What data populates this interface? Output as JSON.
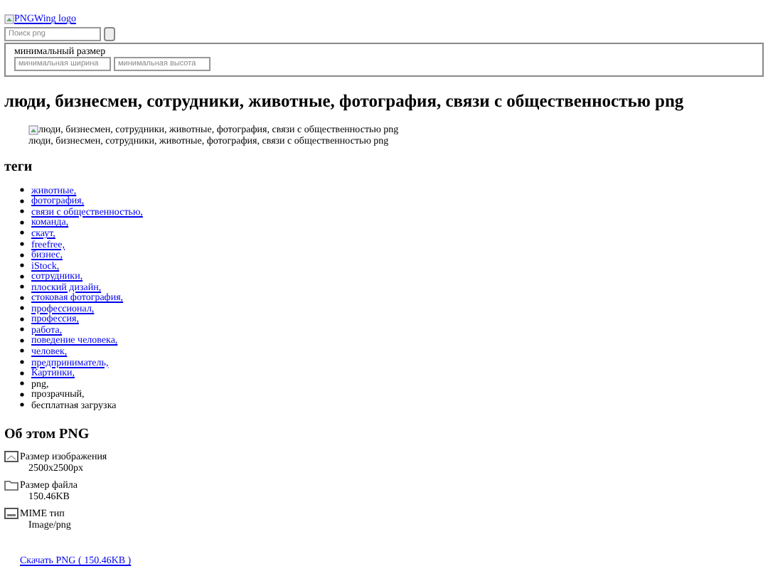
{
  "header": {
    "logo_alt": "PNGWing logo",
    "search": {
      "placeholder": "Поиск png"
    },
    "filter": {
      "legend": "минимальный размер",
      "fields": [
        {
          "placeholder": "минимальная ширина"
        },
        {
          "placeholder": "минимальная высота"
        }
      ]
    }
  },
  "title": "люди, бизнесмен, сотрудники, животные, фотография, связи с общественностью png",
  "image": {
    "alt": "люди, бизнесмен, сотрудники, животные, фотография, связи с общественностью png",
    "caption": "люди, бизнесмен, сотрудники, животные, фотография, связи с общественностью png"
  },
  "tags": {
    "heading": "теги",
    "items": [
      {
        "label": "животные,",
        "kind": "link"
      },
      {
        "label": "фотография,",
        "kind": "link"
      },
      {
        "label": "связи с общественностью,",
        "kind": "link"
      },
      {
        "label": "команда,",
        "kind": "link"
      },
      {
        "label": "скаут,",
        "kind": "link"
      },
      {
        "label": "freefree,",
        "kind": "link"
      },
      {
        "label": "бизнес,",
        "kind": "link"
      },
      {
        "label": "iStock,",
        "kind": "link"
      },
      {
        "label": "сотрудники,",
        "kind": "link"
      },
      {
        "label": "плоский дизайн,",
        "kind": "link"
      },
      {
        "label": "стоковая фотография,",
        "kind": "link"
      },
      {
        "label": "профессионал,",
        "kind": "link"
      },
      {
        "label": "профессия,",
        "kind": "link"
      },
      {
        "label": "работа,",
        "kind": "link"
      },
      {
        "label": "поведение человека,",
        "kind": "link"
      },
      {
        "label": "человек,",
        "kind": "link"
      },
      {
        "label": "предприниматель,",
        "kind": "link"
      },
      {
        "label": "Картинки,",
        "kind": "link"
      },
      {
        "label": "png,",
        "kind": "plain"
      },
      {
        "label": "прозрачный,",
        "kind": "plain"
      },
      {
        "label": "бесплатная загрузка",
        "kind": "plain"
      }
    ]
  },
  "about": {
    "heading": "Об этом PNG",
    "rows": [
      {
        "kind": "image",
        "label": "Размер изображения",
        "value": "2500x2500px"
      },
      {
        "kind": "folder",
        "label": "Размер файла",
        "value": "150.46KB"
      },
      {
        "kind": "mime",
        "label": "MIME тип",
        "value": "Image/png"
      }
    ],
    "download": "Скачать PNG ( 150.46KB )"
  }
}
